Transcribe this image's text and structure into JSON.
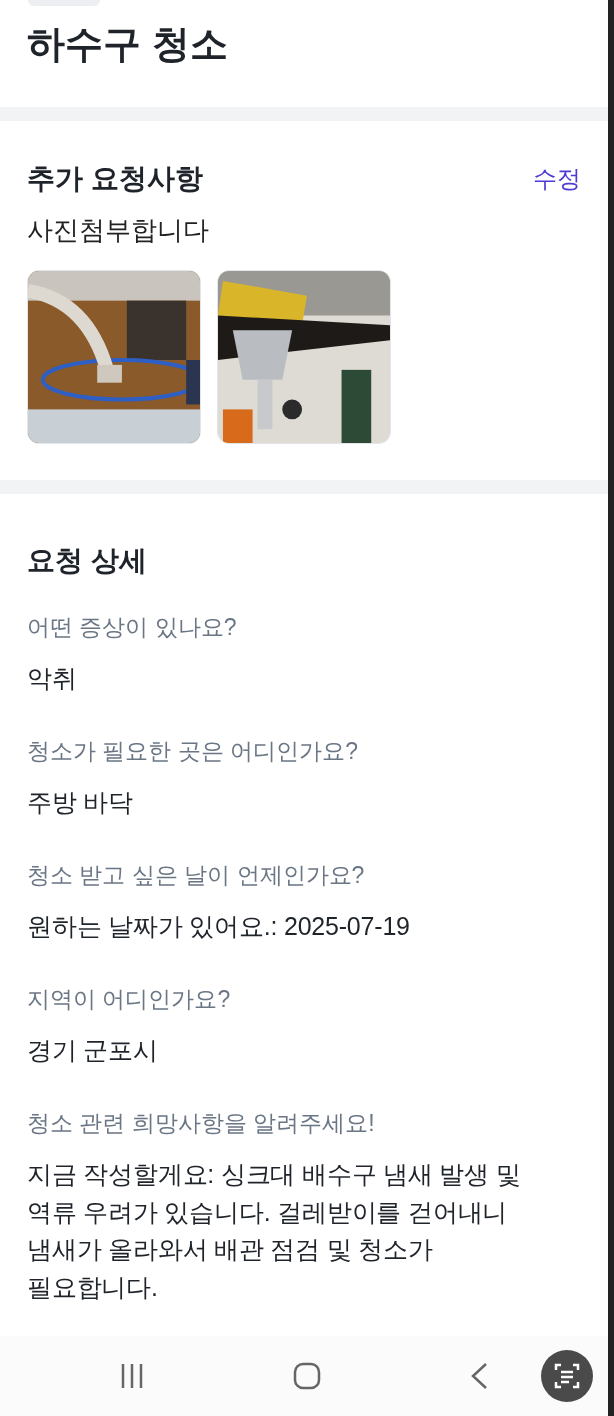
{
  "header": {
    "title": "하수구 청소"
  },
  "extra_requests": {
    "heading": "추가 요청사항",
    "edit_link": "수정",
    "note": "사진첨부합니다"
  },
  "details": {
    "heading": "요청 상세",
    "items": [
      {
        "question": "어떤 증상이 있나요?",
        "answer": "악취"
      },
      {
        "question": "청소가 필요한 곳은 어디인가요?",
        "answer": "주방 바닥"
      },
      {
        "question": "청소 받고 싶은 날이 언제인가요?",
        "answer": "원하는 날짜가 있어요.: 2025-07-19"
      },
      {
        "question": "지역이 어디인가요?",
        "answer": "경기 군포시"
      },
      {
        "question": "청소 관련 희망사항을 알려주세요!",
        "answer": "지금 작성할게요: 싱크대 배수구 냄새 발생 및 역류 우려가 있습니다. 걸레받이를 걷어내니 냄새가 올라와서 배관 점검 및 청소가 필요합니다."
      }
    ]
  }
}
